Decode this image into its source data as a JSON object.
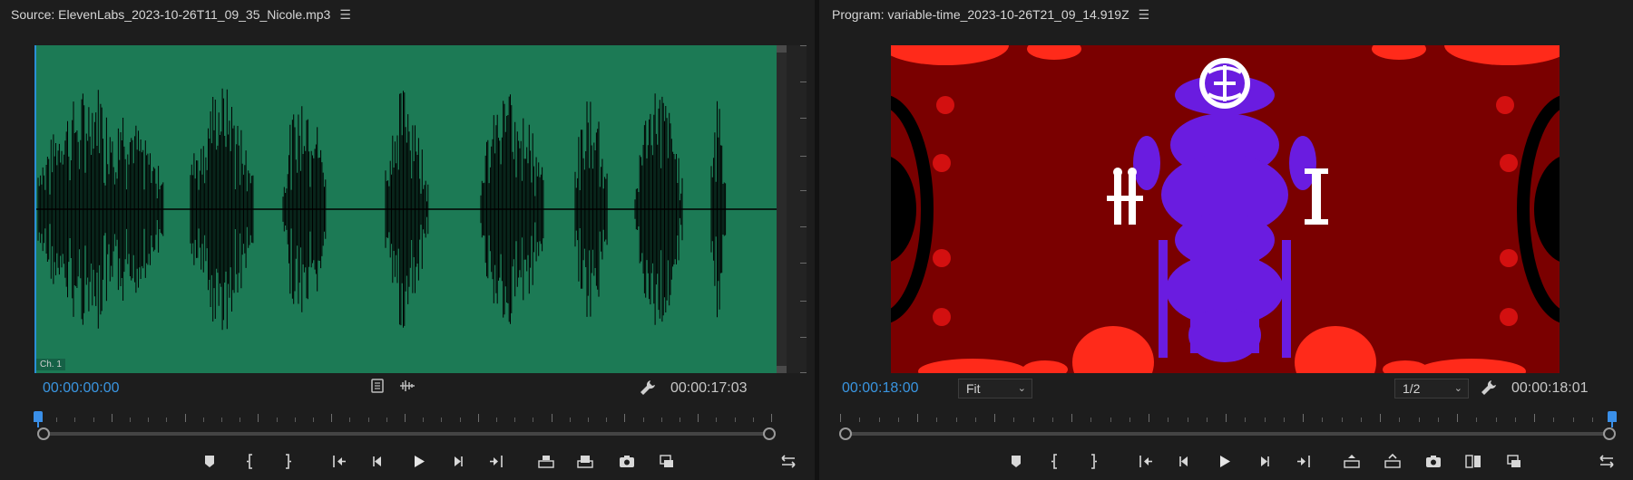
{
  "source": {
    "title": "Source: ElevenLabs_2023-10-26T11_09_35_Nicole.mp3",
    "menu_icon": "hamburger-icon",
    "channel_label": "Ch. 1",
    "timecode_current": "00:00:00:00",
    "timecode_duration": "00:00:17:03",
    "playhead_fraction": 0.0,
    "waveform_color": "#1c7a55",
    "playhead_color": "#3a95e0",
    "transport": [
      "add-marker-icon",
      "mark-in-icon",
      "mark-out-icon",
      "go-to-in-icon",
      "step-back-icon",
      "play-icon",
      "step-forward-icon",
      "go-to-out-icon",
      "insert-icon",
      "overwrite-icon",
      "export-frame-icon",
      "toggle-proxies-icon",
      "button-editor-icon"
    ]
  },
  "program": {
    "title": "Program: variable-time_2023-10-26T21_09_14.919Z",
    "menu_icon": "hamburger-icon",
    "timecode_current": "00:00:18:00",
    "timecode_duration": "00:00:18:01",
    "fit_label": "Fit",
    "resolution_label": "1/2",
    "playhead_fraction": 1.0,
    "video_bg_color": "#7a0000",
    "transport": [
      "add-marker-icon",
      "mark-in-icon",
      "mark-out-icon",
      "go-to-in-icon",
      "step-back-icon",
      "play-icon",
      "step-forward-icon",
      "go-to-out-icon",
      "lift-icon",
      "extract-icon",
      "export-frame-icon",
      "comparison-view-icon",
      "toggle-proxies-icon",
      "button-editor-icon"
    ]
  }
}
